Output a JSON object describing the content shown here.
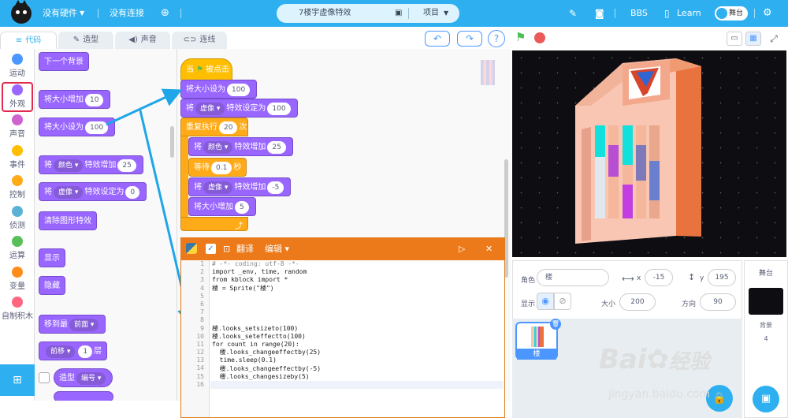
{
  "topbar": {
    "hardware": "没有硬件",
    "connection": "没有连接",
    "project_title": "7楼宇虚像特效",
    "project_menu": "项目",
    "bbs": "BBS",
    "learn": "Learn",
    "stage_toggle": "舞台"
  },
  "tabs": {
    "code": "代码",
    "costume": "造型",
    "sound": "声音",
    "connect": "连线"
  },
  "categories": [
    {
      "label": "运动",
      "color": "#4c97ff"
    },
    {
      "label": "外观",
      "color": "#9966ff"
    },
    {
      "label": "声音",
      "color": "#cf63cf"
    },
    {
      "label": "事件",
      "color": "#ffbf00"
    },
    {
      "label": "控制",
      "color": "#ffab19"
    },
    {
      "label": "侦测",
      "color": "#5cb1d6"
    },
    {
      "label": "运算",
      "color": "#59c059"
    },
    {
      "label": "变量",
      "color": "#ff8c1a"
    },
    {
      "label": "自制积木",
      "color": "#ff6680"
    }
  ],
  "palette": {
    "next_backdrop": "下一个背景",
    "change_size": "将大小增加",
    "change_size_val": "10",
    "set_size": "将大小设为",
    "set_size_val": "100",
    "jiang": "将",
    "color_opt": "颜色",
    "effect_change": "特效增加",
    "effect_change_val": "25",
    "ghost_opt": "虚像",
    "effect_set": "特效设定为",
    "effect_set_val": "0",
    "clear_effects": "清除图形特效",
    "show": "显示",
    "hide": "隐藏",
    "goto_layer": "移到最",
    "front": "前面",
    "go_layer": "前移",
    "layer_val": "1",
    "layer": "层",
    "costume": "造型",
    "number": "编号"
  },
  "script": {
    "when_flag": "当",
    "clicked": "被点击",
    "set_size": "将大小设为",
    "set_size_val": "100",
    "jiang": "将",
    "ghost_opt": "虚像",
    "effect_set": "特效设定为",
    "effect_set_val": "100",
    "repeat": "重复执行",
    "repeat_val": "20",
    "times": "次",
    "color_opt": "颜色",
    "effect_change": "特效增加",
    "effect_change_val": "25",
    "wait": "等待",
    "wait_val": "0.1",
    "sec": "秒",
    "effect_change_val2": "-5",
    "change_size": "将大小增加",
    "change_size_val": "5"
  },
  "editor": {
    "translate": "翻译",
    "edit": "编辑",
    "lines": [
      "# -*- coding: utf-8 -*-",
      "import _env, time, random",
      "from kblock import *",
      "楼 = Sprite(\"楼\")",
      "",
      "",
      "",
      "",
      "楼.looks_setsizeto(100)",
      "楼.looks_seteffectto(100)",
      "for count in range(20):",
      "  楼.looks_changeeffectby(25)",
      "  time.sleep(0.1)",
      "  楼.looks_changeeffectby(-5)",
      "  楼.looks_changesizeby(5)",
      ""
    ],
    "line_numbers": [
      "1",
      "2",
      "3",
      "4",
      "5",
      "6",
      "7",
      "8",
      "9",
      "10",
      "11",
      "12",
      "13",
      "14",
      "15",
      "16"
    ]
  },
  "sprite_info": {
    "role_label": "角色",
    "role_name": "楼",
    "x_label": "x",
    "x_val": "-15",
    "y_label": "y",
    "y_val": "195",
    "show_label": "显示",
    "size_label": "大小",
    "size_val": "200",
    "dir_label": "方向",
    "dir_val": "90"
  },
  "sprites": [
    {
      "name": "楼"
    }
  ],
  "stage_panel": {
    "title": "舞台",
    "backdrop_label": "背景",
    "backdrop_count": "4"
  },
  "watermark": {
    "brand": "Bai",
    "brand2": "经验",
    "url": "jingyan.baidu.com"
  }
}
